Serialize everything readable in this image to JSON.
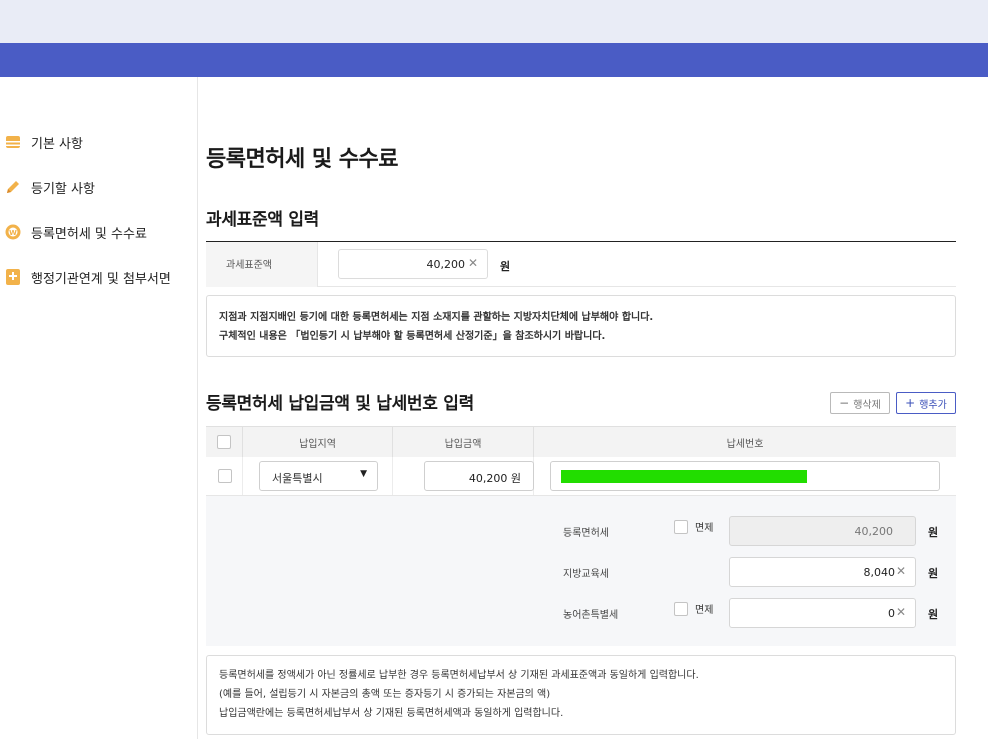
{
  "sidebar": {
    "items": [
      {
        "label": "기본 사항",
        "icon": "document-icon"
      },
      {
        "label": "등기할 사항",
        "icon": "pencil-icon"
      },
      {
        "label": "등록면허세 및 수수료",
        "icon": "coin-icon"
      },
      {
        "label": "행정기관연계 및 첨부서면",
        "icon": "plus-document-icon"
      }
    ]
  },
  "page": {
    "title": "등록면허세 및 수수료"
  },
  "tax_base": {
    "section_title": "과세표준액 입력",
    "label": "과세표준액",
    "value": "40,200",
    "unit": "원",
    "clear": "✕"
  },
  "notice1": {
    "line1": "지점과 지점지배인 등기에 대한 등록면허세는 지점 소재지를 관할하는 지방자치단체에 납부해야 합니다.",
    "line2": "구체적인 내용은 「법인등기 시 납부해야 할 등록면허세 산정기준」을 참조하시기 바랍니다."
  },
  "payment": {
    "section_title": "등록면허세 납입금액 및 납세번호 입력",
    "delete_label": "행삭제",
    "delete_symbol": "−",
    "add_label": "행추가",
    "add_symbol": "+",
    "columns": [
      "납입지역",
      "납입금액",
      "납세번호"
    ],
    "row": {
      "region": "서울특별시",
      "caret": "▼",
      "amount": "40,200 원"
    }
  },
  "details": {
    "registration_tax": {
      "label": "등록면허세",
      "exempt_label": "면제",
      "value": "40,200",
      "unit": "원"
    },
    "education_tax": {
      "label": "지방교육세",
      "value": "8,040",
      "unit": "원",
      "clear": "✕"
    },
    "rural_tax": {
      "label": "농어촌특별세",
      "exempt_label": "면제",
      "value": "0",
      "unit": "원",
      "clear": "✕"
    }
  },
  "notice2": {
    "line1": "등록면허세를 정액세가 아닌 정률세로 납부한 경우 등록면허세납부서 상 기재된 과세표준액과 동일하게 입력합니다.",
    "line2": "(예를 들어, 설립등기 시 자본금의 총액 또는 증자등기 시 증가되는 자본금의 액)",
    "line3": "납입금액란에는 등록면허세납부서 상 기재된 등록면허세액과 동일하게 입력합니다."
  },
  "colors": {
    "accent": "#4a5cc5",
    "top_bar": "#e9ecf6",
    "redacted": "#22dd00"
  }
}
